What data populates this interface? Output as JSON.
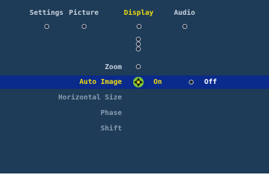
{
  "tabs": [
    {
      "label": "Settings",
      "active": false
    },
    {
      "label": "Picture",
      "active": false
    },
    {
      "label": "Display",
      "active": true
    },
    {
      "label": "Audio",
      "active": false
    }
  ],
  "menu": {
    "zoom": "Zoom",
    "auto_image": "Auto Image",
    "horizontal_size": "Horizontal Size",
    "phase": "Phase",
    "shift": "Shift"
  },
  "auto_image_options": {
    "on": "On",
    "off": "Off",
    "selected": "On"
  },
  "colors": {
    "background": "#1e3c58",
    "highlight": "#0a2a8c",
    "active_tab": "#f0dc14",
    "selector": "#7ec832"
  }
}
